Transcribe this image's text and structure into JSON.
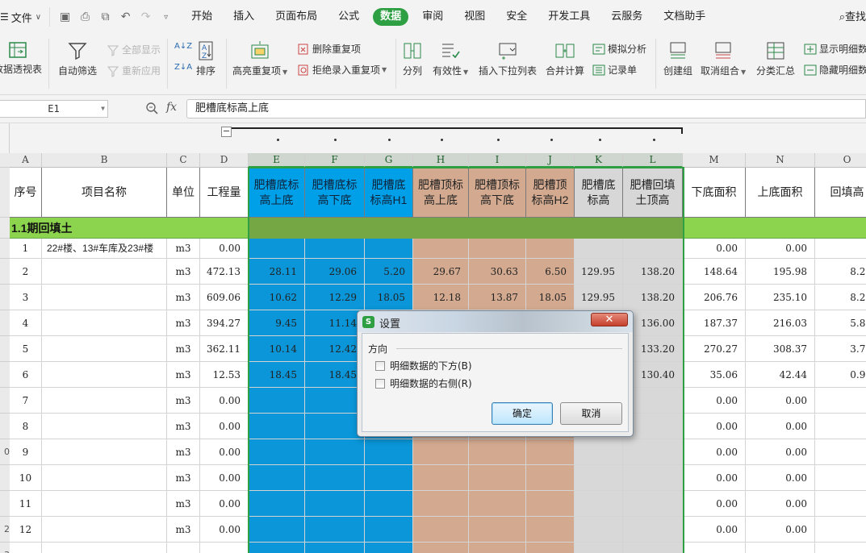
{
  "menu": {
    "file": "文件",
    "tabs": [
      "开始",
      "插入",
      "页面布局",
      "公式",
      "数据",
      "审阅",
      "视图",
      "安全",
      "开发工具",
      "云服务",
      "文档助手"
    ],
    "active_tab": "数据",
    "search": "查找"
  },
  "ribbon": {
    "pivot": "数据透视表",
    "autofilter": "自动筛选",
    "show_all": "全部显示",
    "reapply": "重新应用",
    "sort": "排序",
    "highlight_dup": "高亮重复项",
    "remove_dup": "删除重复项",
    "reject_dup": "拒绝录入重复项",
    "split": "分列",
    "validity": "有效性",
    "dropdown": "插入下拉列表",
    "consolidate": "合并计算",
    "simulate": "模拟分析",
    "record": "记录单",
    "create_group": "创建组",
    "ungroup": "取消组合",
    "subtotal": "分类汇总",
    "show_detail": "显示明细数",
    "hide_detail": "隐藏明细数"
  },
  "formula_bar": {
    "name_box": "E1",
    "fx": "fx",
    "content": "肥槽底标高上底"
  },
  "columns": [
    "A",
    "B",
    "C",
    "D",
    "E",
    "F",
    "G",
    "H",
    "I",
    "J",
    "K",
    "L",
    "M",
    "N",
    "O"
  ],
  "headers": [
    "序号",
    "项目名称",
    "单位",
    "工程量",
    "肥槽底标高上底",
    "肥槽底标高下底",
    "肥槽底标高H1",
    "肥槽顶标高上底",
    "肥槽顶标高下底",
    "肥槽顶标高H2",
    "肥槽底标高",
    "肥槽回填土顶高",
    "下底面积",
    "上底面积",
    "回填高"
  ],
  "section": "1.1期回填土",
  "row_heads": [
    "",
    "",
    "",
    "",
    "",
    "",
    "",
    "",
    "0",
    "",
    "",
    "2",
    "3",
    "4",
    ""
  ],
  "rows": [
    [
      "1",
      "22#楼、13#车库及23#楼",
      "m3",
      "0.00",
      "",
      "",
      "",
      "",
      "",
      "",
      "",
      "",
      "0.00",
      "0.00",
      "0"
    ],
    [
      "2",
      "",
      "m3",
      "472.13",
      "28.11",
      "29.06",
      "5.20",
      "29.67",
      "30.63",
      "6.50",
      "129.95",
      "138.20",
      "148.64",
      "195.98",
      "8.25"
    ],
    [
      "3",
      "",
      "m3",
      "609.06",
      "10.62",
      "12.29",
      "18.05",
      "12.18",
      "13.87",
      "18.05",
      "129.95",
      "138.20",
      "206.76",
      "235.10",
      "8.25"
    ],
    [
      "4",
      "",
      "m3",
      "394.27",
      "9.45",
      "11.14",
      "",
      "",
      "",
      "",
      "",
      "136.00",
      "187.37",
      "216.03",
      "5.85"
    ],
    [
      "5",
      "",
      "m3",
      "362.11",
      "10.14",
      "12.42",
      "",
      "",
      "",
      "",
      "",
      "133.20",
      "270.27",
      "308.37",
      "3.75"
    ],
    [
      "6",
      "",
      "m3",
      "12.53",
      "18.45",
      "18.45",
      "",
      "",
      "",
      "",
      "",
      "130.40",
      "35.06",
      "42.44",
      "0.95"
    ],
    [
      "7",
      "",
      "m3",
      "0.00",
      "",
      "",
      "",
      "",
      "",
      "",
      "",
      "",
      "0.00",
      "0.00",
      "0"
    ],
    [
      "8",
      "",
      "m3",
      "0.00",
      "",
      "",
      "",
      "",
      "",
      "",
      "",
      "",
      "0.00",
      "0.00",
      "0"
    ],
    [
      "9",
      "",
      "m3",
      "0.00",
      "",
      "",
      "",
      "",
      "",
      "",
      "",
      "",
      "0.00",
      "0.00",
      "0"
    ],
    [
      "10",
      "",
      "m3",
      "0.00",
      "",
      "",
      "",
      "",
      "",
      "",
      "",
      "",
      "0.00",
      "0.00",
      "0"
    ],
    [
      "11",
      "",
      "m3",
      "0.00",
      "",
      "",
      "",
      "",
      "",
      "",
      "",
      "",
      "0.00",
      "0.00",
      "0"
    ],
    [
      "12",
      "",
      "m3",
      "0.00",
      "",
      "",
      "",
      "",
      "",
      "",
      "",
      "",
      "0.00",
      "0.00",
      "0"
    ]
  ],
  "dialog": {
    "title": "设置",
    "close": "✕",
    "group": "方向",
    "option_below": "明细数据的下方(B)",
    "option_right": "明细数据的右侧(R)",
    "ok": "确定",
    "cancel": "取消"
  },
  "colors": {
    "accent": "#2ea043",
    "blue_band": "#0a96d8",
    "tan_band": "#d3aa90",
    "gray_band": "#d8d8d8",
    "section_green": "#8cd44e"
  }
}
